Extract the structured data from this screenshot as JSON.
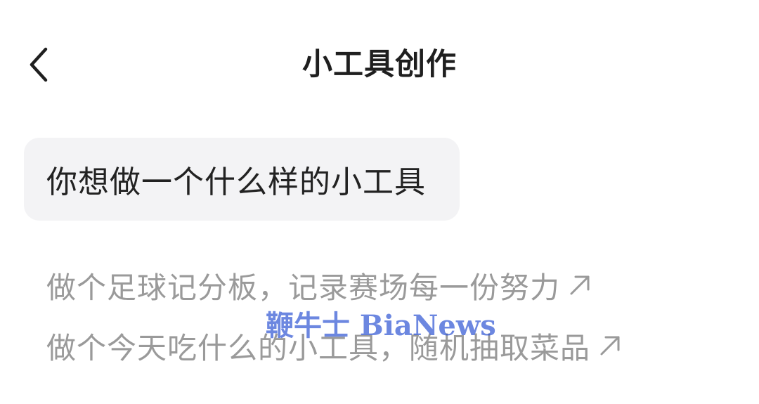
{
  "header": {
    "title": "小工具创作",
    "back_icon": "chevron-left-icon"
  },
  "prompt": {
    "text": "你想做一个什么样的小工具"
  },
  "suggestions": [
    {
      "label": "做个足球记分板，记录赛场每一份努力",
      "icon": "arrow-up-right-icon"
    },
    {
      "label": "做个今天吃什么的小工具，随机抽取菜品",
      "icon": "arrow-up-right-icon"
    }
  ],
  "watermark": {
    "text": "鞭牛士 BiaNews"
  },
  "colors": {
    "title": "#1f1f1f",
    "prompt_bg": "#f3f3f5",
    "suggestion_text": "#9a9a9a",
    "watermark": "#2f55d4"
  }
}
